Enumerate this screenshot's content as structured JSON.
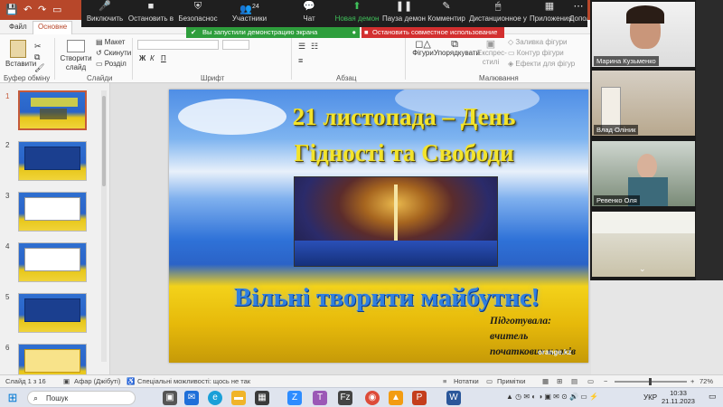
{
  "titlebar": {
    "file_tab": "Файл",
    "home_tab": "Основне"
  },
  "ribbon_tabs": [
    "Файл",
    "Основне"
  ],
  "zoom_toolbar": {
    "items": [
      {
        "label": "Виключить",
        "icon": "microphone-icon"
      },
      {
        "label": "Остановить в",
        "icon": "video-camera-icon"
      },
      {
        "label": "Безопаснос",
        "icon": "shield-icon"
      },
      {
        "label": "Участники",
        "icon": "participants-icon",
        "count": "24"
      },
      {
        "label": "Чат",
        "icon": "chat-icon"
      },
      {
        "label": "Новая демон",
        "icon": "share-screen-icon",
        "active": true
      },
      {
        "label": "Пауза демон",
        "icon": "pause-icon"
      },
      {
        "label": "Комментир",
        "icon": "annotate-icon"
      },
      {
        "label": "Дистанционное у",
        "icon": "remote-control-icon"
      },
      {
        "label": "Приложения",
        "icon": "apps-icon"
      },
      {
        "label": "Дополнит",
        "icon": "more-icon"
      }
    ],
    "share_notice": "Вы запустили демонстрацию экрана",
    "stop_share": "Остановить совместное использование"
  },
  "ribbon": {
    "paste": "Вставити",
    "new_slide": "Створити слайд",
    "layout": "Макет",
    "reset": "Скинути",
    "section": "Розділ",
    "clipboard_group": "Буфер обміну",
    "slides_group": "Слайди",
    "font_group": "Шрифт",
    "paragraph_group": "Абзац",
    "drawing_group": "Малювання",
    "shapes": "Фігури",
    "arrange": "Упорядкувати",
    "quick_styles": "Експрес-стилі",
    "shape_fill": "Заливка фігури",
    "shape_outline": "Контур фігури",
    "shape_effects": "Ефекти для фігур"
  },
  "slides_panel": {
    "numbers": [
      "1",
      "2",
      "3",
      "4",
      "5",
      "6"
    ]
  },
  "slide": {
    "title_line1": "21 листопада – День",
    "title_line2": "Гідності та Свободи",
    "motto": "Вільні творити майбутнє!",
    "author_line1": "Підготувала: вчитель",
    "author_line2": "початкових класів",
    "logo": "orange.kz"
  },
  "participants": [
    {
      "name": "Марина Кузьменко"
    },
    {
      "name": "Влад Олiник"
    },
    {
      "name": "Ревенко Оля"
    },
    {
      "name": ""
    }
  ],
  "status": {
    "slide": "Слайд 1 з 16",
    "language": "Афар (Джібуті)",
    "accessibility": "Спеціальні можливості: щось не так",
    "notes": "Нотатки",
    "comments": "Примітки",
    "zoom": "72%"
  },
  "taskbar": {
    "search": "Пошук",
    "lang": "УКР",
    "time": "10:33",
    "date": "21.11.2023"
  },
  "colors": {
    "accent": "#b7472a",
    "share_green": "#2e9e3c",
    "share_red": "#d32f2f"
  }
}
